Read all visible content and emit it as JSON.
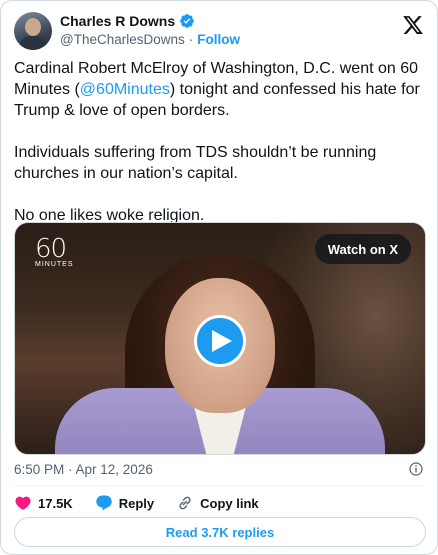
{
  "author": {
    "display_name": "Charles R Downs",
    "handle": "@TheCharlesDowns",
    "separator": "·",
    "follow_label": "Follow"
  },
  "tweet": {
    "para1_before": "Cardinal Robert McElroy of Washington, D.C. went on 60 Minutes (",
    "mention": "@60Minutes",
    "para1_after": ") tonight and confessed his hate for Trump & love of open borders.",
    "para2": "Individuals suffering from TDS shouldn’t be running churches in our nation’s capital.",
    "para3": "No one likes woke religion."
  },
  "media": {
    "logo_number": "60",
    "logo_text": "MINUTES",
    "watch_label": "Watch on X"
  },
  "meta": {
    "timestamp": "6:50 PM · Apr 12, 2026"
  },
  "actions": {
    "like_count": "17.5K",
    "reply_label": "Reply",
    "copy_link_label": "Copy link"
  },
  "replies_button": "Read 3.7K replies",
  "colors": {
    "accent": "#1d9bf0",
    "like": "#f91880",
    "text": "#0f1419",
    "muted": "#536471"
  }
}
